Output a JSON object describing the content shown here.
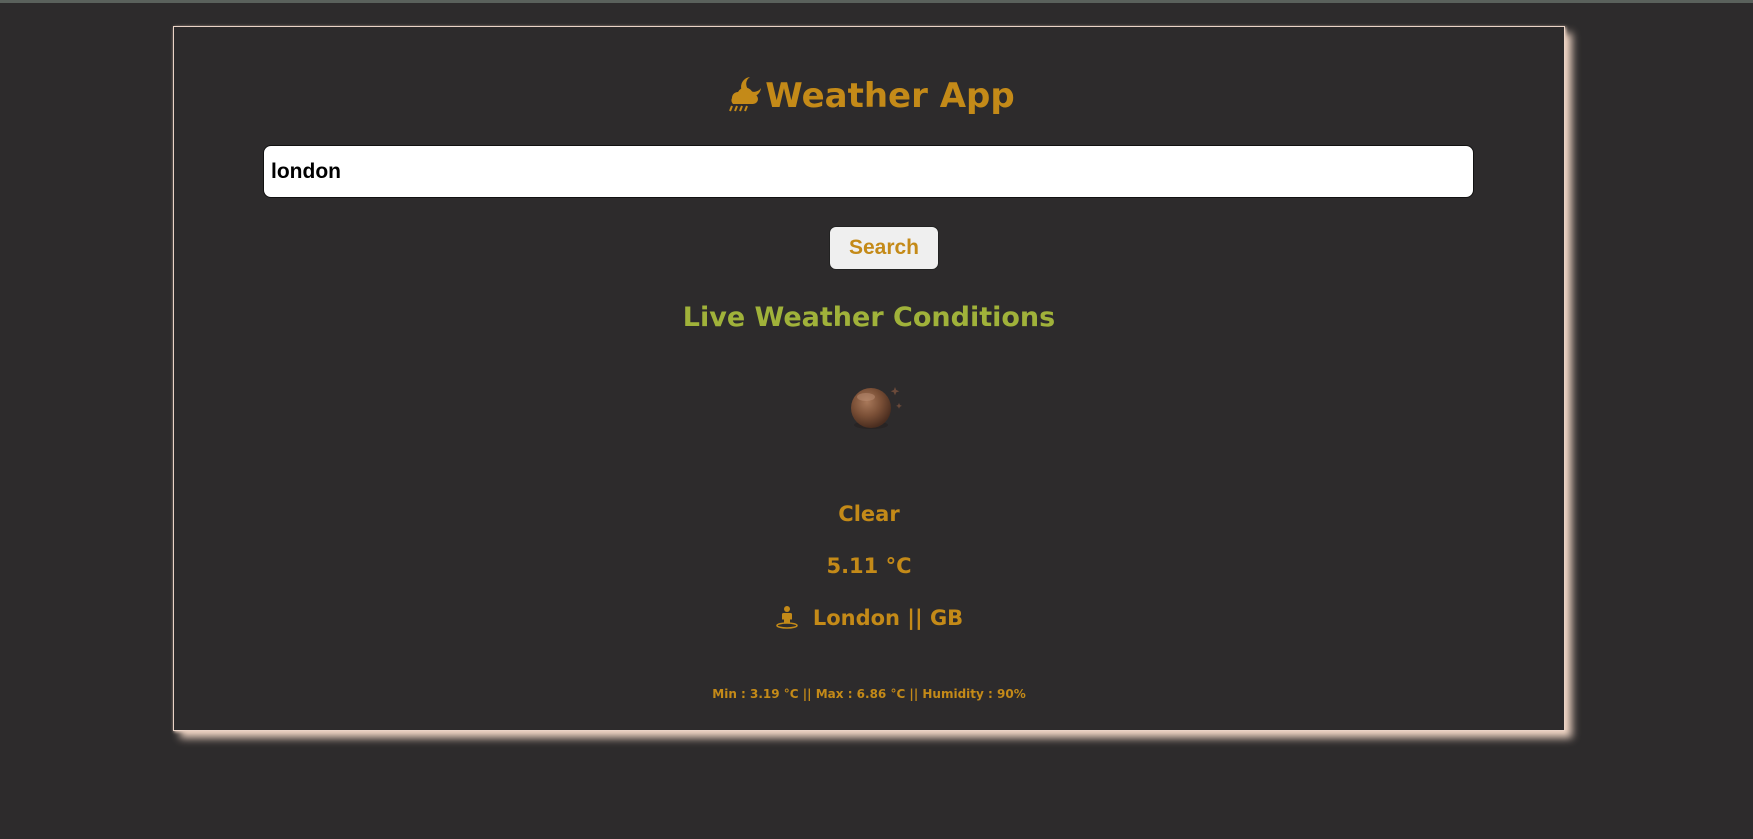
{
  "app": {
    "title": "Weather App",
    "title_icon": "cloud-moon-rain-icon"
  },
  "search": {
    "value": "london",
    "button_label": "Search"
  },
  "section": {
    "title": "Live Weather Conditions"
  },
  "weather": {
    "icon": "clear-night-moon-icon",
    "condition": "Clear",
    "temperature": "5.11 °C",
    "location_icon": "street-view-icon",
    "location": "London || GB",
    "details": "Min : 3.19 °C || Max : 6.86 °C || Humidity : 90%"
  },
  "colors": {
    "background": "#2d2b2c",
    "accent": "#c48a18",
    "section_title": "#a0b23a",
    "card_shadow": "#e9cfbf"
  }
}
